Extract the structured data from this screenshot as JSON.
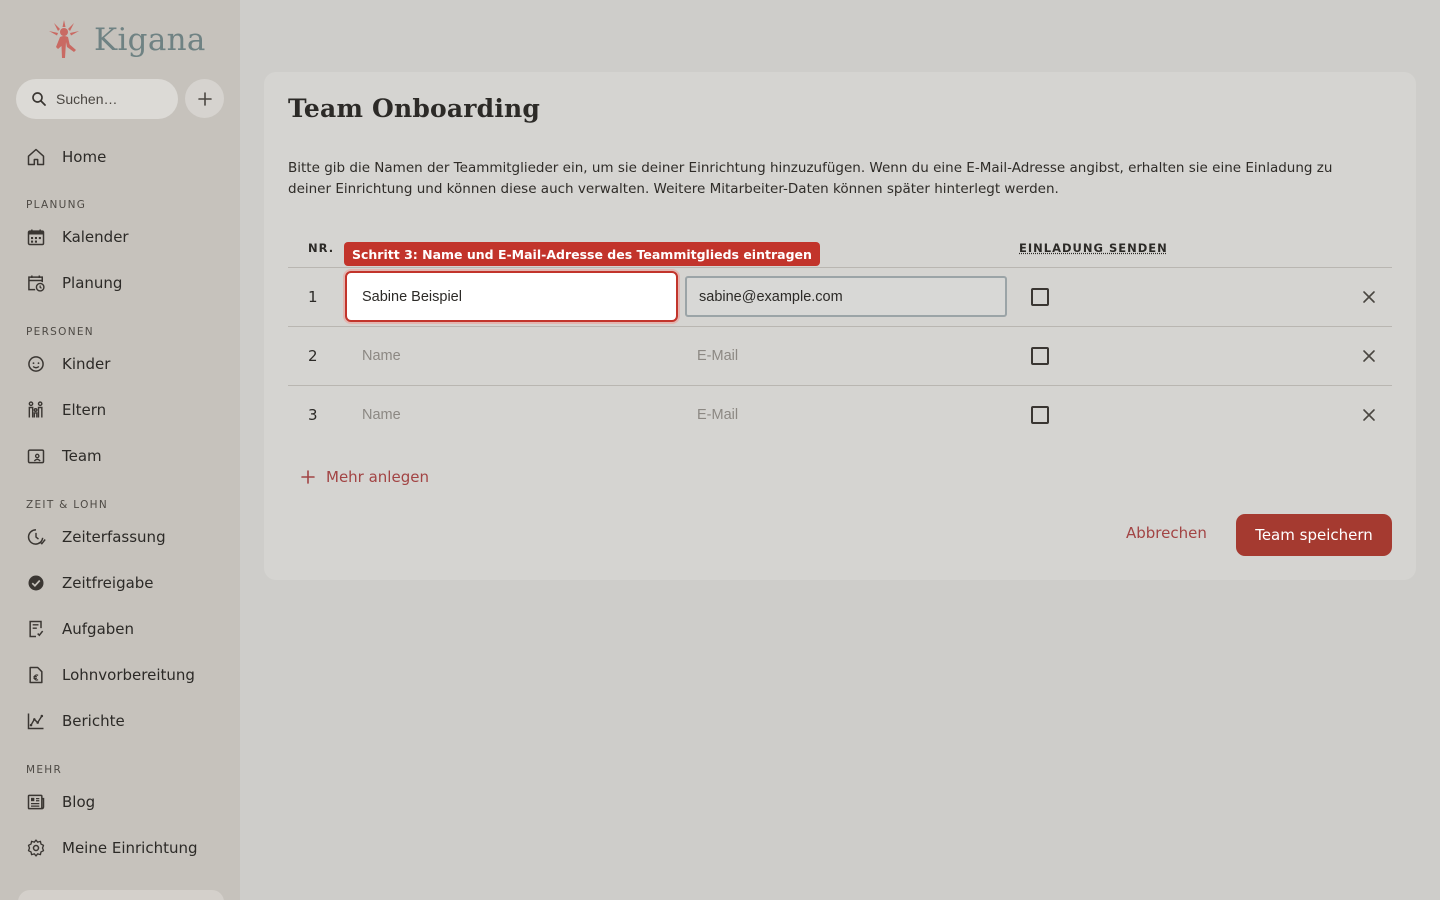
{
  "brand": {
    "name": "Kigana",
    "logo_color": "#c96a63"
  },
  "search": {
    "placeholder": "Suchen…"
  },
  "nav": {
    "home": "Home",
    "sections": {
      "planung": "PLANUNG",
      "personen": "PERSONEN",
      "zeit": "ZEIT & LOHN",
      "mehr": "MEHR"
    },
    "items": {
      "kalender": "Kalender",
      "planung": "Planung",
      "kinder": "Kinder",
      "eltern": "Eltern",
      "team": "Team",
      "zeiterfassung": "Zeiterfassung",
      "zeitfreigabe": "Zeitfreigabe",
      "aufgaben": "Aufgaben",
      "lohnvorbereitung": "Lohnvorbereitung",
      "berichte": "Berichte",
      "blog": "Blog",
      "einrichtung": "Meine Einrichtung"
    }
  },
  "card": {
    "title": "Team Onboarding",
    "description": "Bitte gib die Namen der Teammitglieder ein, um sie deiner Einrichtung hinzuzufügen. Wenn du eine E-Mail-Adresse angibst, erhalten sie eine Einladung zu deiner Einrichtung und können diese auch verwalten. Weitere Mitarbeiter-Daten können später hinterlegt werden.",
    "headers": {
      "nr": "NR.",
      "invite": "EINLADUNG SENDEN"
    },
    "tooltip": "Schritt 3: Name und E-Mail-Adresse des Teammitglieds eintragen",
    "rows": [
      {
        "nr": "1",
        "name": "Sabine Beispiel",
        "email": "sabine@example.com"
      },
      {
        "nr": "2",
        "name_placeholder": "Name",
        "email_placeholder": "E-Mail"
      },
      {
        "nr": "3",
        "name_placeholder": "Name",
        "email_placeholder": "E-Mail"
      }
    ],
    "add_more": "Mehr anlegen",
    "cancel": "Abbrechen",
    "save": "Team speichern"
  },
  "colors": {
    "accent": "#a53a30",
    "highlight": "#c2342b"
  }
}
